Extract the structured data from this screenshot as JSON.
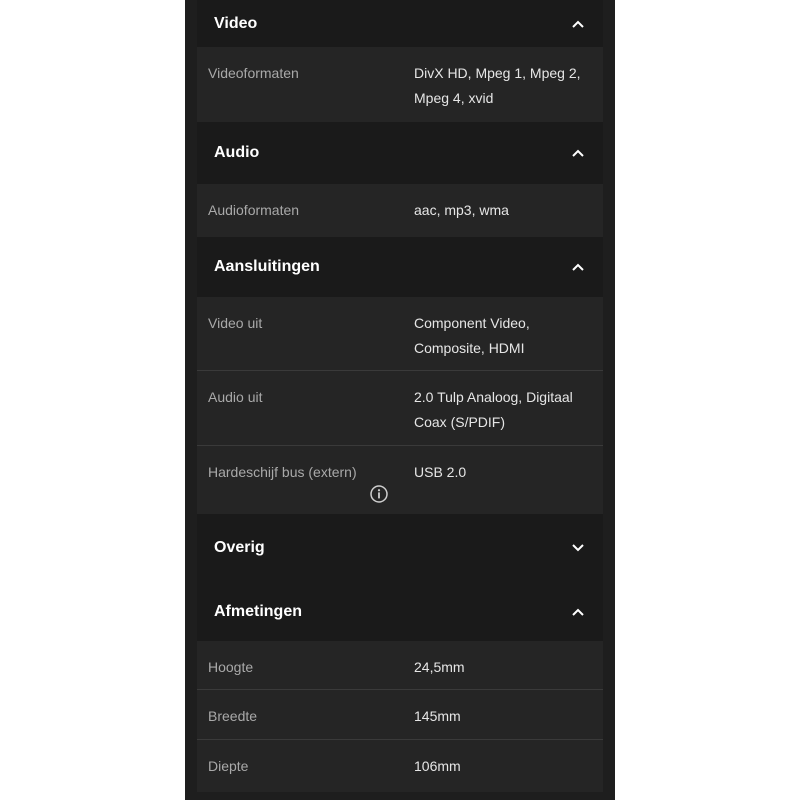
{
  "colors": {
    "panel_bg": "#1e1e1e",
    "header_bg": "#1a1a1a",
    "row_bg": "#252525",
    "divider": "#3a3a3a"
  },
  "sections": {
    "video": {
      "title": "Video",
      "state": "expanded",
      "rows": [
        {
          "label": "Videoformaten",
          "value": "DivX HD, Mpeg 1, Mpeg 2, Mpeg 4, xvid"
        }
      ]
    },
    "audio": {
      "title": "Audio",
      "state": "expanded",
      "rows": [
        {
          "label": "Audioformaten",
          "value": "aac, mp3, wma"
        }
      ]
    },
    "aansluitingen": {
      "title": "Aansluitingen",
      "state": "expanded",
      "rows": [
        {
          "label": "Video uit",
          "value": "Component Video, Composite, HDMI"
        },
        {
          "label": "Audio uit",
          "value": "2.0 Tulp Analoog, Digitaal Coax (S/PDIF)"
        },
        {
          "label": "Hardeschijf bus (extern)",
          "value": "USB 2.0",
          "icon": "info-icon"
        }
      ]
    },
    "overig": {
      "title": "Overig",
      "state": "collapsed"
    },
    "afmetingen": {
      "title": "Afmetingen",
      "state": "expanded",
      "rows": [
        {
          "label": "Hoogte",
          "value": "24,5mm"
        },
        {
          "label": "Breedte",
          "value": "145mm"
        },
        {
          "label": "Diepte",
          "value": "106mm"
        }
      ]
    }
  }
}
